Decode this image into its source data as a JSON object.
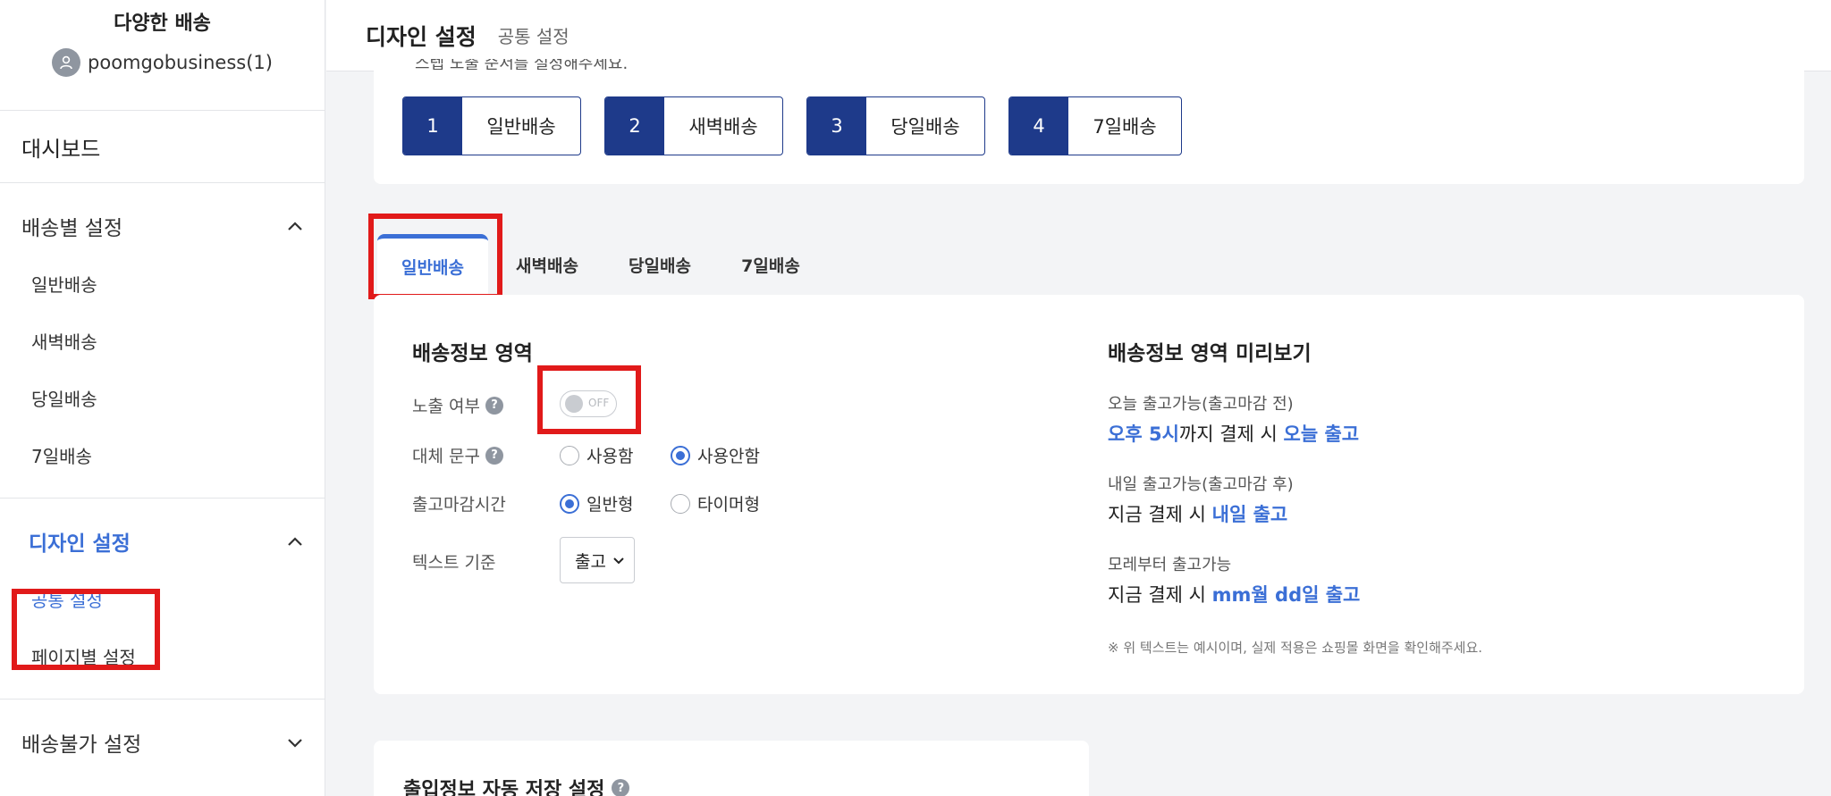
{
  "sidebar": {
    "title": "다양한 배송",
    "user": "poomgobusiness(1)",
    "dashboard": "대시보드",
    "group1": {
      "title": "배송별 설정",
      "items": [
        "일반배송",
        "새벽배송",
        "당일배송",
        "7일배송"
      ]
    },
    "group2": {
      "title": "디자인 설정",
      "items": [
        "공통 설정",
        "페이지별 설정"
      ]
    },
    "group3": {
      "title": "배송불가 설정"
    }
  },
  "header": {
    "title": "디자인 설정",
    "subtitle": "공통 설정"
  },
  "steps": [
    {
      "num": "1",
      "label": "일반배송"
    },
    {
      "num": "2",
      "label": "새벽배송"
    },
    {
      "num": "3",
      "label": "당일배송"
    },
    {
      "num": "4",
      "label": "7일배송"
    }
  ],
  "steps_top_text": "스텝 노출 순서를 설정해주세요.",
  "tabs": [
    "일반배송",
    "새벽배송",
    "당일배송",
    "7일배송"
  ],
  "form": {
    "section_title": "배송정보 영역",
    "exposure_label": "노출 여부",
    "toggle_text": "OFF",
    "alt_text_label": "대체 문구",
    "alt_use": "사용함",
    "alt_not_use": "사용안함",
    "cutoff_label": "출고마감시간",
    "cutoff_normal": "일반형",
    "cutoff_timer": "타이머형",
    "text_basis_label": "텍스트 기준",
    "text_basis_value": "출고"
  },
  "preview": {
    "title": "배송정보 영역 미리보기",
    "case1_label": "오늘 출고가능(출고마감 전)",
    "case1_hl1": "오후 5시",
    "case1_mid": "까지 결제 시 ",
    "case1_hl2": "오늘 출고",
    "case2_label": "내일 출고가능(출고마감 후)",
    "case2_pre": "지금 결제 시 ",
    "case2_hl": "내일 출고",
    "case3_label": "모레부터 출고가능",
    "case3_pre": "지금 결제 시 ",
    "case3_hl": "mm월 dd일 출고",
    "note": "※ 위 텍스트는 예시이며, 실제 적용은 쇼핑몰 화면을 확인해주세요."
  },
  "bottom": {
    "title": "출입정보 자동 저장 설정"
  },
  "colors": {
    "accent": "#3b6fd6",
    "navy": "#1e3a8a",
    "highlight_box": "#e11a1a"
  }
}
